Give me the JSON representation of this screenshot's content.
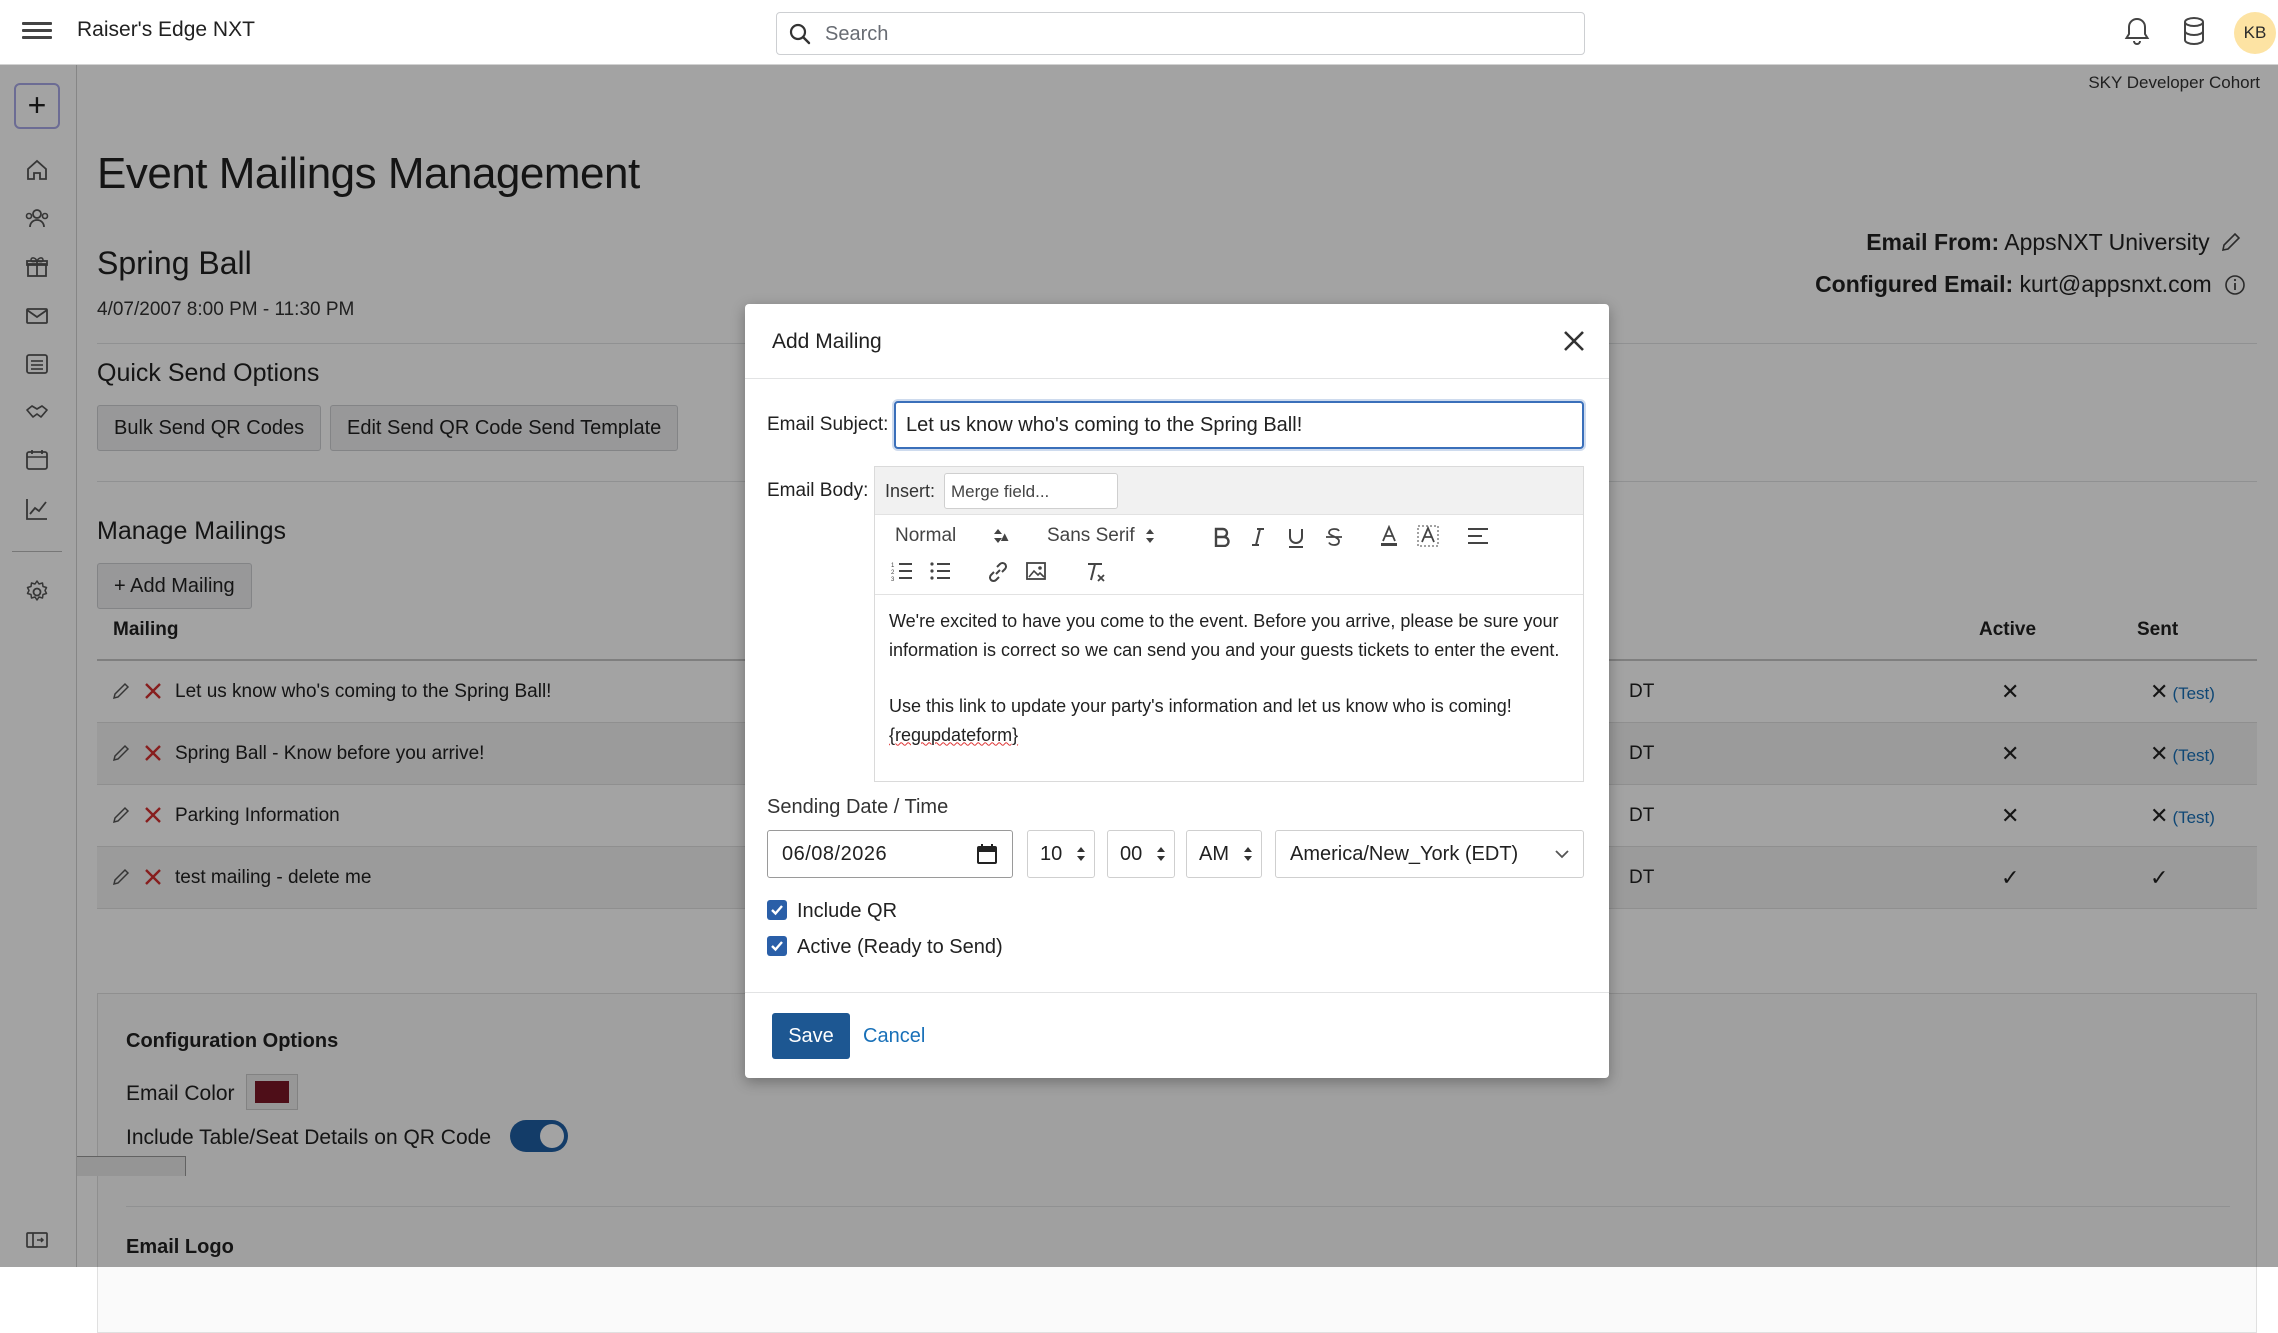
{
  "app": {
    "title": "Raiser's Edge NXT",
    "search_placeholder": "Search",
    "user_initials": "KB",
    "org": "SKY Developer Cohort"
  },
  "page": {
    "title": "Event Mailings Management",
    "event_name": "Spring Ball",
    "event_date": "4/07/2007 8:00 PM - 11:30 PM",
    "email_from_label": "Email From:",
    "email_from_value": "AppsNXT University",
    "configured_label": "Configured Email:",
    "configured_value": "kurt@appsnxt.com",
    "quick_send_title": "Quick Send Options",
    "bulk_send_label": "Bulk Send QR Codes",
    "edit_template_label": "Edit Send QR Code Send Template",
    "manage_title": "Manage Mailings",
    "add_mailing_label": "+ Add Mailing"
  },
  "table": {
    "headers": {
      "mailing": "Mailing",
      "active": "Active",
      "sent": "Sent"
    },
    "rows": [
      {
        "name": "Let us know who's coming to the Spring Ball!",
        "time": "DT",
        "active": "✕",
        "sent": "✕",
        "sent_link": "(Test)"
      },
      {
        "name": "Spring Ball - Know before you arrive!",
        "time": "DT",
        "active": "✕",
        "sent": "✕",
        "sent_link": "(Test)"
      },
      {
        "name": "Parking Information",
        "time": "DT",
        "active": "✕",
        "sent": "✕",
        "sent_link": "(Test)"
      },
      {
        "name": "test mailing - delete me",
        "time": "DT",
        "active": "✓",
        "sent": "✓",
        "sent_link": ""
      }
    ]
  },
  "config": {
    "title": "Configuration Options",
    "email_color_label": "Email Color",
    "email_color": "#7a1726",
    "seat_details_label": "Include Table/Seat Details on QR Code",
    "seat_details_on": true,
    "logo_title": "Email Logo"
  },
  "modal": {
    "title": "Add Mailing",
    "subject_label": "Email Subject:",
    "subject_value": "Let us know who's coming to the Spring Ball!",
    "body_label": "Email Body:",
    "insert_label": "Insert:",
    "merge_placeholder": "Merge field...",
    "format_select": "Normal",
    "font_select": "Sans Serif",
    "body_p1": "We're excited to have you come to the event. Before you arrive, please be sure your information is correct so we can send you and your guests tickets to enter the event.",
    "body_p2": "Use this link to update your party's information and let us know who is coming!",
    "body_p3": "{regupdateform}",
    "send_label": "Sending Date / Time",
    "date": "06/08/2026",
    "hour": "10",
    "minute": "00",
    "ampm": "AM",
    "timezone": "America/New_York (EDT)",
    "include_qr_label": "Include QR",
    "include_qr": true,
    "active_label": "Active (Ready to Send)",
    "active": true,
    "save_label": "Save",
    "cancel_label": "Cancel"
  },
  "colors": {
    "accent": "#1d5792",
    "link": "#1870b8",
    "delete": "#d32f2f",
    "overlay": "rgba(0,0,0,0.36)"
  },
  "icons": [
    "menu-icon",
    "search-icon",
    "bell-icon",
    "database-icon",
    "plus-icon",
    "home-icon",
    "constituents-icon",
    "gift-icon",
    "mail-icon",
    "list-icon",
    "handshake-icon",
    "calendar-icon",
    "chart-icon",
    "gear-icon",
    "collapse-icon",
    "edit-icon",
    "delete-icon",
    "close-icon"
  ]
}
